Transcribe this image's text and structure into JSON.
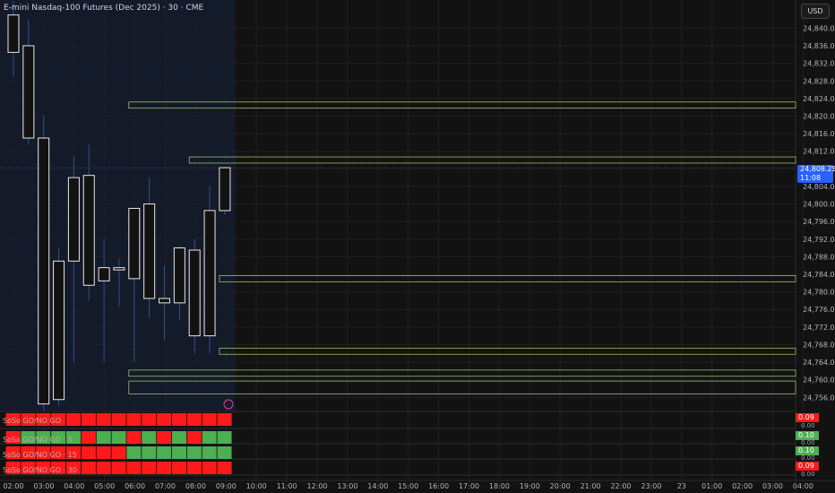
{
  "header": {
    "title": "E-mini Nasdaq-100 Futures (Dec 2025) · 30 · CME",
    "currency_button": "USD"
  },
  "last_price": {
    "value": "24,808.25",
    "countdown": "11:08"
  },
  "colors": {
    "background": "#121212",
    "candle_border_up": "#2f4e8f",
    "candle_body_up": "#ffffff",
    "candle_body_down": "#121212",
    "session_shade": "#131a2a",
    "zone_line": "#9bbf6b",
    "price_tag": "#2962ff",
    "signal_go": "#4caf50",
    "signal_nogo": "#ff1b1b"
  },
  "chart_data": {
    "type": "candlestick",
    "y_axis": {
      "ylim": [
        24753,
        24846
      ],
      "ticks": [
        "24,840.00",
        "24,836.00",
        "24,832.00",
        "24,828.00",
        "24,824.00",
        "24,820.00",
        "24,816.00",
        "24,812.00",
        "24,808.00",
        "24,804.00",
        "24,800.00",
        "24,796.00",
        "24,792.00",
        "24,788.00",
        "24,784.00",
        "24,780.00",
        "24,776.00",
        "24,772.00",
        "24,768.00",
        "24,764.00",
        "24,760.00",
        "24,756.00"
      ]
    },
    "x_axis": {
      "ticks": [
        "02:00",
        "03:00",
        "04:00",
        "05:00",
        "06:00",
        "07:00",
        "08:00",
        "09:00",
        "10:00",
        "11:00",
        "12:00",
        "13:00",
        "14:00",
        "15:00",
        "16:00",
        "17:00",
        "18:00",
        "19:00",
        "20:00",
        "21:00",
        "22:00",
        "23:00",
        "23",
        "01:00",
        "02:00",
        "03:00",
        "04:00"
      ]
    },
    "candles": [
      {
        "open": 24834.5,
        "high": 24846.0,
        "low": 24829.0,
        "close": 24843.0
      },
      {
        "open": 24836.0,
        "high": 24842.0,
        "low": 24813.5,
        "close": 24815.0
      },
      {
        "open": 24815.0,
        "high": 24820.0,
        "low": 24753.0,
        "close": 24754.5
      },
      {
        "open": 24755.5,
        "high": 24790.0,
        "low": 24754.0,
        "close": 24787.0
      },
      {
        "open": 24787.0,
        "high": 24811.0,
        "low": 24764.0,
        "close": 24806.0
      },
      {
        "open": 24806.5,
        "high": 24813.5,
        "low": 24778.0,
        "close": 24781.5
      },
      {
        "open": 24782.5,
        "high": 24792.0,
        "low": 24764.0,
        "close": 24785.5
      },
      {
        "open": 24785.5,
        "high": 24787.5,
        "low": 24776.5,
        "close": 24785.0
      },
      {
        "open": 24783.0,
        "high": 24799.0,
        "low": 24764.0,
        "close": 24799.0
      },
      {
        "open": 24800.0,
        "high": 24806.0,
        "low": 24774.0,
        "close": 24778.5
      },
      {
        "open": 24778.5,
        "high": 24786.0,
        "low": 24769.0,
        "close": 24777.5
      },
      {
        "open": 24777.5,
        "high": 24790.5,
        "low": 24773.5,
        "close": 24790.0
      },
      {
        "open": 24789.5,
        "high": 24792.0,
        "low": 24766.0,
        "close": 24770.0
      },
      {
        "open": 24770.0,
        "high": 24804.0,
        "low": 24766.0,
        "close": 24798.5
      },
      {
        "open": 24798.5,
        "high": 24808.5,
        "low": 24797.5,
        "close": 24808.25
      }
    ],
    "zones": [
      {
        "top": 24823.0,
        "bottom": 24822.0,
        "start_candle": 8
      },
      {
        "top": 24810.5,
        "bottom": 24809.5,
        "start_candle": 12
      },
      {
        "top": 24783.5,
        "bottom": 24782.5,
        "start_candle": 14
      },
      {
        "top": 24767.0,
        "bottom": 24766.0,
        "start_candle": 14
      },
      {
        "top": 24762.0,
        "bottom": 24761.0,
        "start_candle": 8
      },
      {
        "top": 24759.5,
        "bottom": 24757.0,
        "start_candle": 8
      }
    ]
  },
  "indicators": [
    {
      "label": "SoSo GO/NO GO",
      "value": "0.09",
      "zero": "0.00",
      "badge": "nogo",
      "signals": [
        "nogo",
        "nogo",
        "nogo",
        "nogo",
        "nogo",
        "nogo",
        "nogo",
        "nogo",
        "nogo",
        "nogo",
        "nogo",
        "nogo",
        "nogo",
        "nogo",
        "nogo"
      ]
    },
    {
      "label": "SoSo GO/NO GO · 5",
      "value": "0.10",
      "zero": "0.00",
      "badge": "go",
      "signals": [
        "nogo",
        "go",
        "go",
        "go",
        "go",
        "nogo",
        "go",
        "go",
        "nogo",
        "go",
        "nogo",
        "go",
        "nogo",
        "go",
        "go"
      ]
    },
    {
      "label": "SoSo GO/NO GO · 15",
      "value": "0.10",
      "zero": "0.00",
      "badge": "go",
      "signals": [
        "nogo",
        "nogo",
        "nogo",
        "nogo",
        "nogo",
        "nogo",
        "nogo",
        "nogo",
        "go",
        "go",
        "go",
        "go",
        "go",
        "go",
        "go"
      ]
    },
    {
      "label": "SoSo GO/NO GO · 30",
      "value": "0.09",
      "zero": "0.00",
      "badge": "nogo",
      "signals": [
        "nogo",
        "nogo",
        "nogo",
        "nogo",
        "nogo",
        "nogo",
        "nogo",
        "nogo",
        "nogo",
        "nogo",
        "nogo",
        "nogo",
        "nogo",
        "nogo",
        "nogo"
      ]
    }
  ]
}
